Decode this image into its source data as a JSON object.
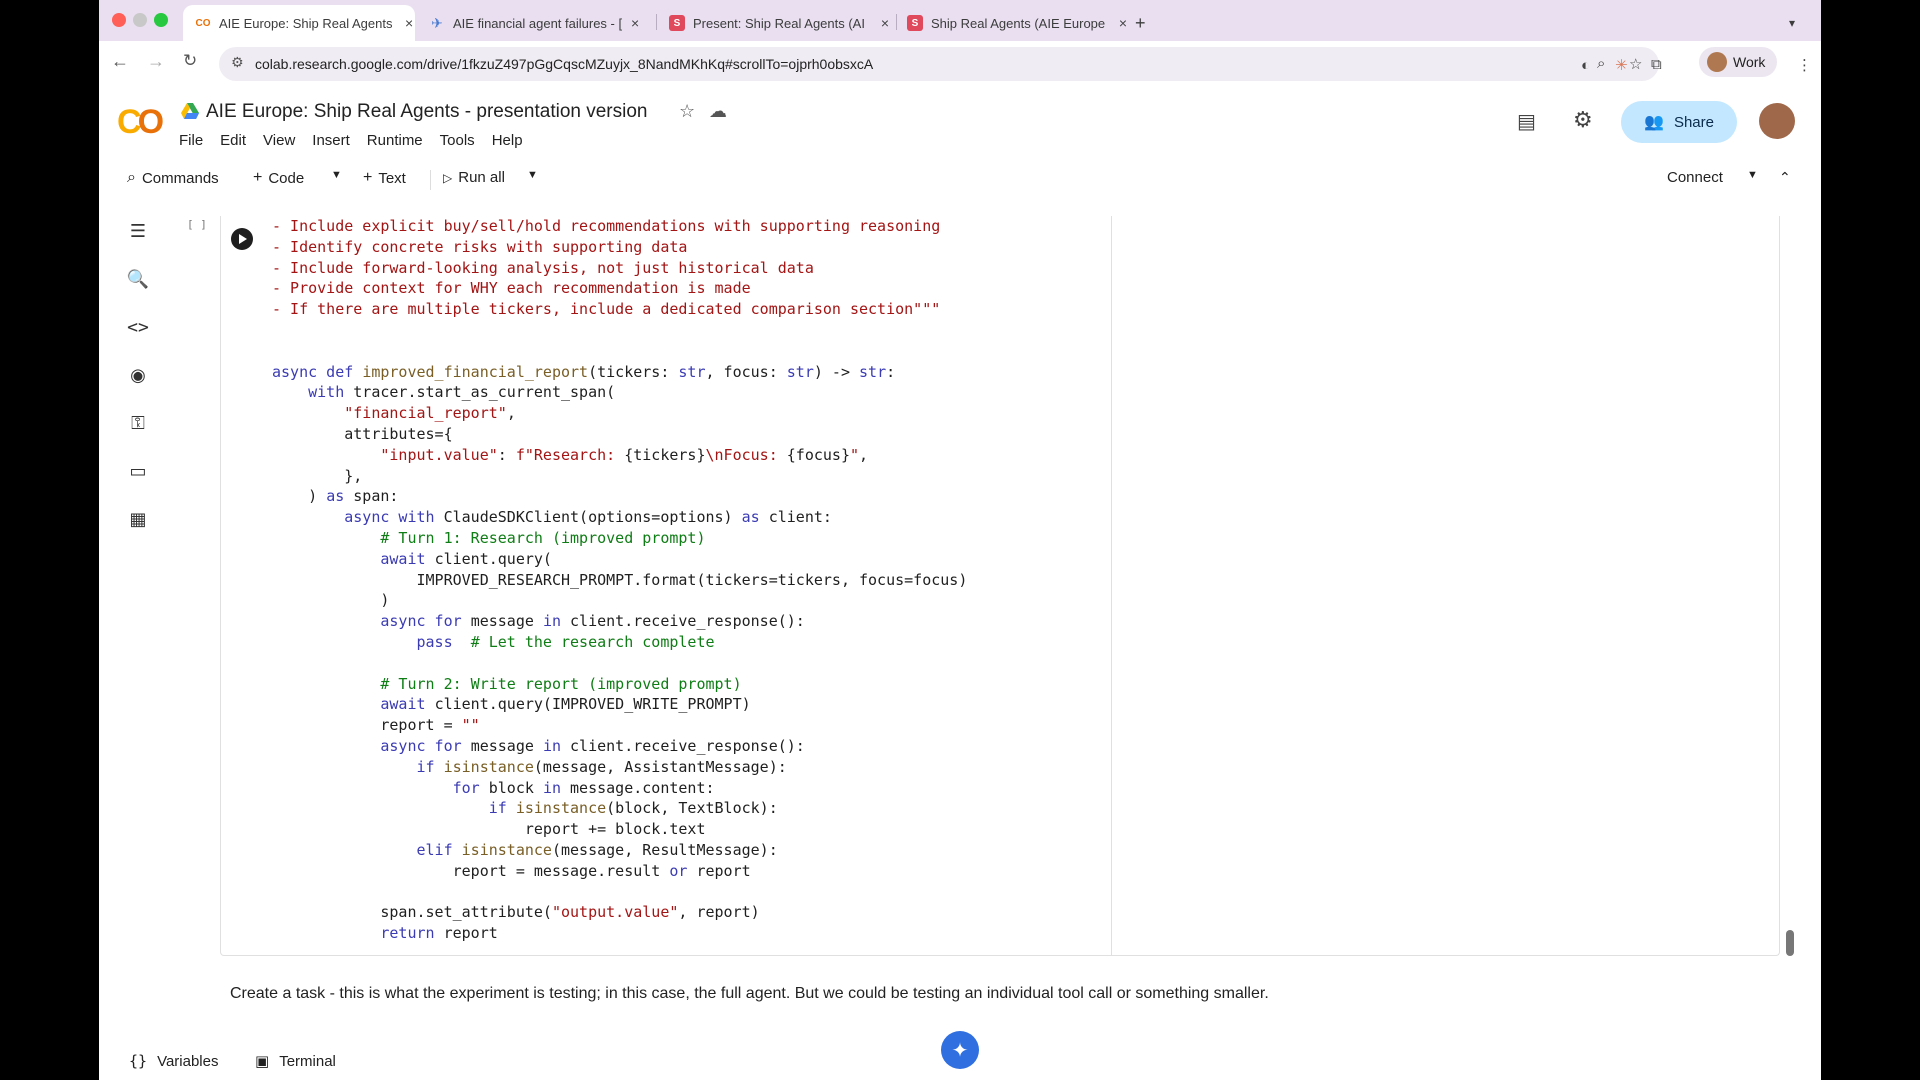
{
  "browser": {
    "tabs": [
      {
        "title": "AIE Europe: Ship Real Agents",
        "favicon": "colab-icon",
        "active": true
      },
      {
        "title": "AIE financial agent failures - [",
        "favicon": "arize-icon",
        "active": false
      },
      {
        "title": "Present: Ship Real Agents (AI",
        "favicon": "slides-icon",
        "active": false
      },
      {
        "title": "Ship Real Agents (AIE Europe",
        "favicon": "slides-icon",
        "active": false
      }
    ],
    "close_glyph": "×",
    "new_tab_glyph": "+",
    "url": "colab.research.google.com/drive/1fkzuZ497pGgCqscMZuyjx_8NandMKhKq#scrollTo=ojprh0obsxcA",
    "profile_label": "Work"
  },
  "colab": {
    "logo_text": [
      "C",
      "O"
    ],
    "title": "AIE Europe: Ship Real Agents - presentation version",
    "menu": [
      "File",
      "Edit",
      "View",
      "Insert",
      "Runtime",
      "Tools",
      "Help"
    ],
    "share_label": "Share"
  },
  "toolbar": {
    "commands_label": "Commands",
    "code_label": "Code",
    "text_label": "Text",
    "run_all_label": "Run all",
    "connect_label": "Connect"
  },
  "cell": {
    "bracket": "[ ]",
    "code_lines": [
      [
        [
          "s",
          "- Include explicit buy/sell/hold recommendations with supporting reasoning"
        ]
      ],
      [
        [
          "s",
          "- Identify concrete risks with supporting data"
        ]
      ],
      [
        [
          "s",
          "- Include forward-looking analysis, not just historical data"
        ]
      ],
      [
        [
          "s",
          "- Provide context for WHY each recommendation is made"
        ]
      ],
      [
        [
          "s",
          "- If there are multiple tickers, include a dedicated comparison section\"\"\""
        ]
      ],
      [],
      [],
      [
        [
          "k",
          "async def "
        ],
        [
          "f",
          "improved_financial_report"
        ],
        [
          "",
          "(tickers: "
        ],
        [
          "k",
          "str"
        ],
        [
          "",
          ", focus: "
        ],
        [
          "k",
          "str"
        ],
        [
          "",
          ") -> "
        ],
        [
          "k",
          "str"
        ],
        [
          "",
          ":"
        ]
      ],
      [
        [
          "",
          "    "
        ],
        [
          "k",
          "with "
        ],
        [
          "",
          "tracer.start_as_current_span("
        ]
      ],
      [
        [
          "",
          "        "
        ],
        [
          "s",
          "\"financial_report\""
        ],
        [
          "",
          ","
        ]
      ],
      [
        [
          "",
          "        attributes={"
        ]
      ],
      [
        [
          "",
          "            "
        ],
        [
          "s",
          "\"input.value\""
        ],
        [
          "",
          ": "
        ],
        [
          "s",
          "f\"Research: "
        ],
        [
          "",
          "{tickers}"
        ],
        [
          "s",
          "\\nFocus: "
        ],
        [
          "",
          "{focus}"
        ],
        [
          "s",
          "\""
        ],
        [
          "",
          ","
        ]
      ],
      [
        [
          "",
          "        },"
        ]
      ],
      [
        [
          "",
          "    ) "
        ],
        [
          "k",
          "as "
        ],
        [
          "",
          "span:"
        ]
      ],
      [
        [
          "",
          "        "
        ],
        [
          "k",
          "async with "
        ],
        [
          "",
          "ClaudeSDKClient(options=options) "
        ],
        [
          "k",
          "as "
        ],
        [
          "",
          "client:"
        ]
      ],
      [
        [
          "",
          "            "
        ],
        [
          "c",
          "# Turn 1: Research (improved prompt)"
        ]
      ],
      [
        [
          "",
          "            "
        ],
        [
          "k",
          "await "
        ],
        [
          "",
          "client.query("
        ]
      ],
      [
        [
          "",
          "                IMPROVED_RESEARCH_PROMPT.format(tickers=tickers, focus=focus)"
        ]
      ],
      [
        [
          "",
          "            )"
        ]
      ],
      [
        [
          "",
          "            "
        ],
        [
          "k",
          "async for "
        ],
        [
          "",
          "message "
        ],
        [
          "k",
          "in "
        ],
        [
          "",
          "client.receive_response():"
        ]
      ],
      [
        [
          "",
          "                "
        ],
        [
          "k",
          "pass  "
        ],
        [
          "c",
          "# Let the research complete"
        ]
      ],
      [],
      [
        [
          "",
          "            "
        ],
        [
          "c",
          "# Turn 2: Write report (improved prompt)"
        ]
      ],
      [
        [
          "",
          "            "
        ],
        [
          "k",
          "await "
        ],
        [
          "",
          "client.query(IMPROVED_WRITE_PROMPT)"
        ]
      ],
      [
        [
          "",
          "            report = "
        ],
        [
          "s",
          "\"\""
        ]
      ],
      [
        [
          "",
          "            "
        ],
        [
          "k",
          "async for "
        ],
        [
          "",
          "message "
        ],
        [
          "k",
          "in "
        ],
        [
          "",
          "client.receive_response():"
        ]
      ],
      [
        [
          "",
          "                "
        ],
        [
          "k",
          "if "
        ],
        [
          "f",
          "isinstance"
        ],
        [
          "",
          "(message, AssistantMessage):"
        ]
      ],
      [
        [
          "",
          "                    "
        ],
        [
          "k",
          "for "
        ],
        [
          "",
          "block "
        ],
        [
          "k",
          "in "
        ],
        [
          "",
          "message.content:"
        ]
      ],
      [
        [
          "",
          "                        "
        ],
        [
          "k",
          "if "
        ],
        [
          "f",
          "isinstance"
        ],
        [
          "",
          "(block, TextBlock):"
        ]
      ],
      [
        [
          "",
          "                            report += block.text"
        ]
      ],
      [
        [
          "",
          "                "
        ],
        [
          "k",
          "elif "
        ],
        [
          "f",
          "isinstance"
        ],
        [
          "",
          "(message, ResultMessage):"
        ]
      ],
      [
        [
          "",
          "                    report = message.result "
        ],
        [
          "k",
          "or "
        ],
        [
          "",
          "report"
        ]
      ],
      [],
      [
        [
          "",
          "            span.set_attribute("
        ],
        [
          "s",
          "\"output.value\""
        ],
        [
          "",
          ", report)"
        ]
      ],
      [
        [
          "",
          "            "
        ],
        [
          "k",
          "return "
        ],
        [
          "",
          "report"
        ]
      ]
    ]
  },
  "text_cell": "Create a task - this is what the experiment is testing; in this case, the full agent. But we could be testing an individual tool call or something smaller.",
  "bottom": {
    "variables_label": "Variables",
    "terminal_label": "Terminal"
  },
  "colors": {
    "tabstrip": "#e9dff0",
    "share_bg": "#c2e7ff",
    "keyword": "#3b3bb3",
    "string": "#a31515",
    "comment": "#0f7d15"
  }
}
